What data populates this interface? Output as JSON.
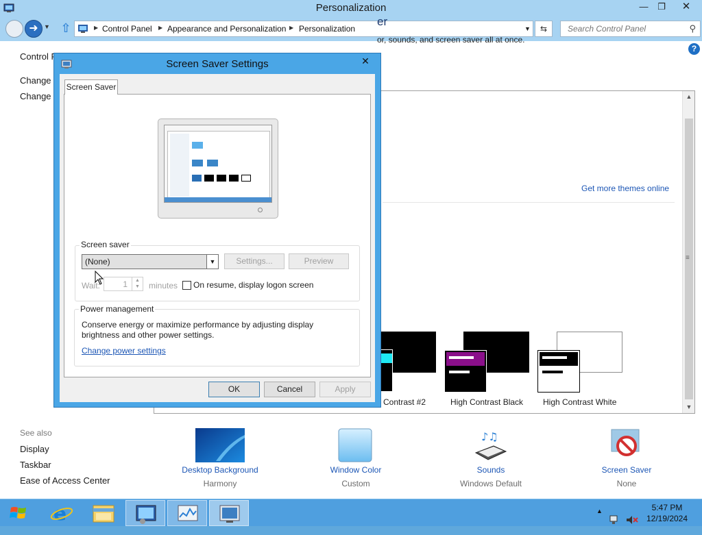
{
  "window": {
    "title": "Personalization",
    "controls": {
      "minimize": "—",
      "maximize": "❐",
      "close": "✕"
    }
  },
  "navigation": {
    "breadcrumbs": [
      "Control Panel",
      "Appearance and Personalization",
      "Personalization"
    ],
    "search_placeholder": "Search Control Panel"
  },
  "left_pane": {
    "top_links": [
      "Control P",
      "Change d",
      "Change m"
    ],
    "see_also_label": "See also",
    "see_also": [
      "Display",
      "Taskbar",
      "Ease of Access Center"
    ]
  },
  "main": {
    "heading_fragment": "er",
    "description_fragment": "or, sounds, and screen saver all at once.",
    "get_more_link": "Get more themes online",
    "themes": [
      {
        "label": "Contrast #2"
      },
      {
        "label": "High Contrast Black"
      },
      {
        "label": "High Contrast White"
      }
    ],
    "bottom_items": [
      {
        "label": "Desktop Background",
        "value": "Harmony",
        "icon": "desktop-background-icon"
      },
      {
        "label": "Window Color",
        "value": "Custom",
        "icon": "window-color-icon"
      },
      {
        "label": "Sounds",
        "value": "Windows Default",
        "icon": "sounds-icon"
      },
      {
        "label": "Screen Saver",
        "value": "None",
        "icon": "screen-saver-icon"
      }
    ]
  },
  "dialog": {
    "title": "Screen Saver Settings",
    "close": "✕",
    "tab": "Screen Saver",
    "screen_saver_group": "Screen saver",
    "selected_saver": "(None)",
    "settings_button": "Settings...",
    "preview_button": "Preview",
    "wait_label": "Wait:",
    "wait_value": "1",
    "minutes_label": "minutes",
    "resume_label": "On resume, display logon screen",
    "resume_checked": false,
    "power_group": "Power management",
    "power_text_line1": "Conserve energy or maximize performance by adjusting display",
    "power_text_line2": "brightness and other power settings.",
    "power_link": "Change power settings",
    "ok_button": "OK",
    "cancel_button": "Cancel",
    "apply_button": "Apply"
  },
  "taskbar": {
    "apps": [
      "start-icon",
      "internet-explorer-icon",
      "file-explorer-icon",
      "control-panel-icon",
      "performance-monitor-icon",
      "personalization-icon"
    ],
    "time": "5:47 PM",
    "date": "12/19/2024"
  },
  "colors": {
    "titlebar": "#a7d3f2",
    "dialog_frame": "#4aa6e6",
    "link": "#1c56b5",
    "taskbar": "#4f9fdf"
  }
}
